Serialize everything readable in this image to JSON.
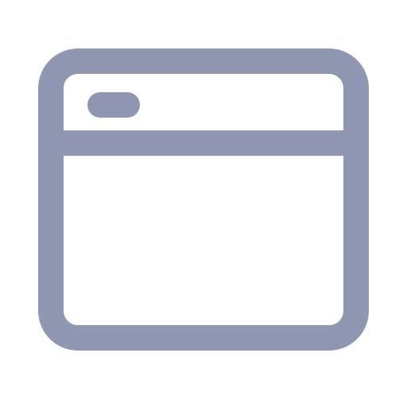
{
  "icon": {
    "name": "browser-window-icon",
    "color": "#8f97b3",
    "background": "#ffffff"
  }
}
